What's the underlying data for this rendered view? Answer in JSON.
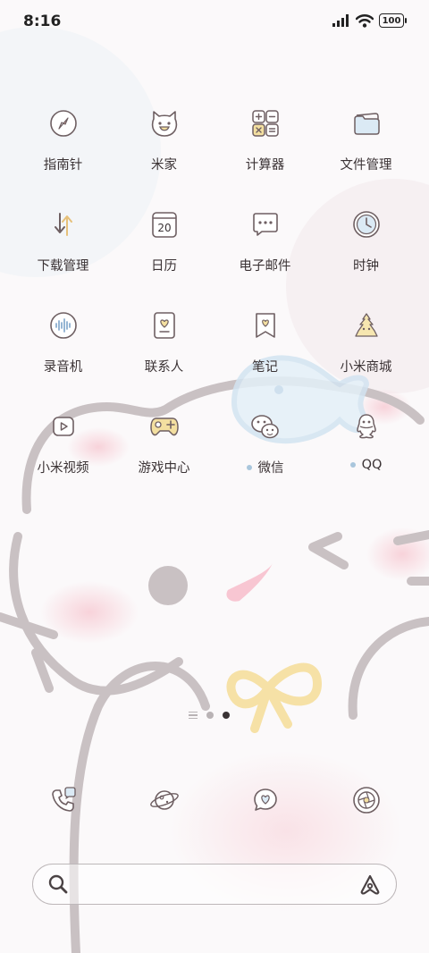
{
  "status_bar": {
    "time": "8:16",
    "battery": "100",
    "icons": [
      "signal-icon",
      "wifi-icon",
      "battery-icon"
    ]
  },
  "apps": [
    {
      "label": "指南针",
      "icon": "compass-icon"
    },
    {
      "label": "米家",
      "icon": "mi-home-icon"
    },
    {
      "label": "计算器",
      "icon": "calculator-icon"
    },
    {
      "label": "文件管理",
      "icon": "folder-icon"
    },
    {
      "label": "下载管理",
      "icon": "download-icon"
    },
    {
      "label": "日历",
      "icon": "calendar-icon",
      "badge": "20"
    },
    {
      "label": "电子邮件",
      "icon": "email-icon"
    },
    {
      "label": "时钟",
      "icon": "clock-icon"
    },
    {
      "label": "录音机",
      "icon": "recorder-icon"
    },
    {
      "label": "联系人",
      "icon": "contacts-icon"
    },
    {
      "label": "笔记",
      "icon": "notes-icon"
    },
    {
      "label": "小米商城",
      "icon": "mi-store-icon"
    },
    {
      "label": "小米视频",
      "icon": "video-icon"
    },
    {
      "label": "游戏中心",
      "icon": "game-center-icon"
    },
    {
      "label": "微信",
      "icon": "wechat-icon",
      "new": true
    },
    {
      "label": "QQ",
      "icon": "qq-icon",
      "new": true
    }
  ],
  "page_indicator": {
    "pages": 2,
    "active": 2
  },
  "dock": [
    {
      "icon": "phone-icon"
    },
    {
      "icon": "browser-planet-icon"
    },
    {
      "icon": "messages-icon"
    },
    {
      "icon": "camera-icon"
    }
  ],
  "search_bar": {
    "icons": [
      "search-icon",
      "assistant-icon"
    ]
  },
  "colors": {
    "icon_stroke": "#6e5f62",
    "accent_yellow": "#f3dfa0",
    "accent_blue": "#dbeaf5",
    "new_dot": "#a9c6dc"
  }
}
